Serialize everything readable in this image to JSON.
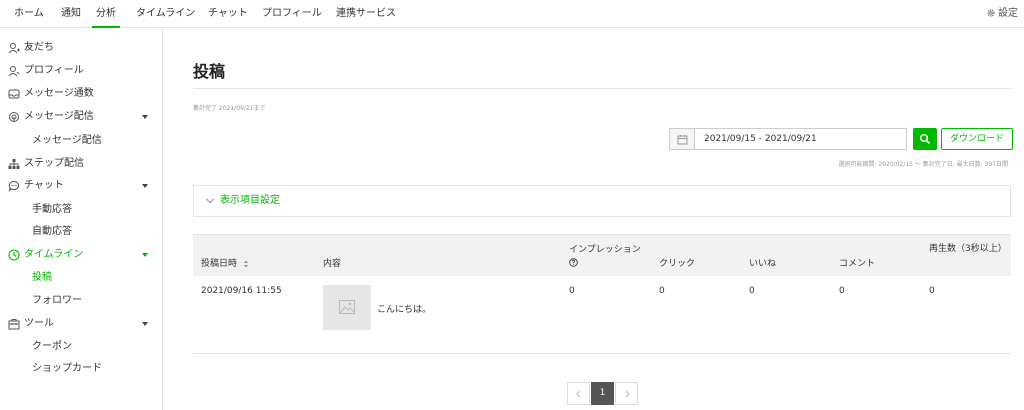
{
  "topnav": {
    "tabs": [
      {
        "label": "ホーム"
      },
      {
        "label": "通知"
      },
      {
        "label": "分析"
      },
      {
        "label": "タイムライン"
      },
      {
        "label": "チャット"
      },
      {
        "label": "プロフィール"
      },
      {
        "label": "連携サービス"
      }
    ],
    "active_tab": "分析",
    "settings_label": "設定"
  },
  "sidebar": {
    "items": [
      {
        "label": "友だち",
        "icon": "person-icon"
      },
      {
        "label": "プロフィール",
        "icon": "profile-icon"
      },
      {
        "label": "メッセージ通数",
        "icon": "inbox-icon"
      },
      {
        "label": "メッセージ配信",
        "icon": "broadcast-icon",
        "expandable": true
      },
      {
        "label": "メッセージ配信"
      },
      {
        "label": "ステップ配信",
        "icon": "hierarchy-icon"
      },
      {
        "label": "チャット",
        "icon": "chat-bubble-icon",
        "expandable": true
      },
      {
        "label": "手動応答"
      },
      {
        "label": "自動応答"
      },
      {
        "label": "タイムライン",
        "icon": "clock-icon",
        "expandable": true,
        "active_section": true
      },
      {
        "label": "投稿",
        "selected": true
      },
      {
        "label": "フォロワー"
      },
      {
        "label": "ツール",
        "icon": "toolbox-icon",
        "expandable": true
      },
      {
        "label": "クーポン"
      },
      {
        "label": "ショップカード"
      }
    ]
  },
  "main": {
    "title": "投稿",
    "aggregation_note": "集計完了 2021/09/21まで",
    "date_range_value": "2021/09/15 - 2021/09/21",
    "download_label": "ダウンロード",
    "range_note": "選択可能期間: 2020/02/15 〜 集計完了日, 最大日数: 397日間",
    "display_settings_label": "表示項目設定",
    "table": {
      "headers": {
        "posted_at": "投稿日時",
        "content": "内容",
        "impressions": "インプレッション",
        "clicks": "クリック",
        "likes": "いいね",
        "comments": "コメント",
        "plays": "再生数（3秒以上）"
      },
      "rows": [
        {
          "posted_at": "2021/09/16 11:55",
          "content": "こんにちは。",
          "impressions": "0",
          "clicks": "0",
          "likes": "0",
          "comments": "0",
          "plays": "0"
        }
      ]
    },
    "pagination": {
      "current_page": "1"
    }
  },
  "colors": {
    "accent": "#00b900",
    "header_bg": "#f2f2f2",
    "border": "#e5e5e5"
  }
}
